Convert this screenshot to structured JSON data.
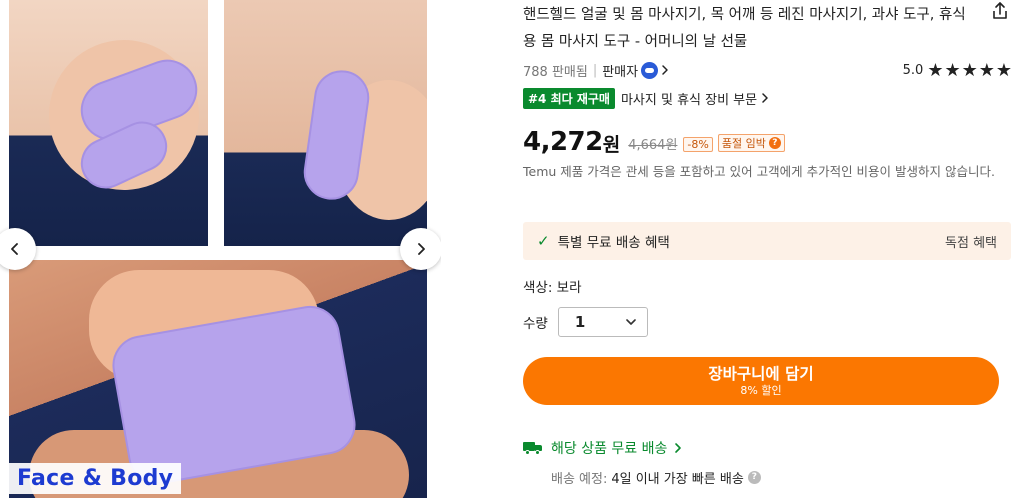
{
  "gallery": {
    "photo_label": "Face & Body",
    "prev_icon": "chevron-left-icon",
    "next_icon": "chevron-right-icon"
  },
  "product": {
    "title": "핸드헬드 얼굴 및 몸 마사지기, 목 어깨 등 레진 마사지기, 과샤 도구, 휴식용 몸 마사지 도구 - 어머니의 날 선물",
    "share_icon": "share-icon",
    "sold_count": "788 판매됨",
    "seller_label": "판매자",
    "rating_value": "5.0",
    "stars": "★★★★★",
    "rank_badge": "#4 최다 재구매",
    "rank_category": "마사지 및 휴식 장비 부문",
    "price": "4,272",
    "price_unit": "원",
    "old_price": "4,664원",
    "discount": "-8%",
    "stock_tag": "품절 임박",
    "notice": "Temu 제품 가격은 관세 등을 포함하고 있어 고객에게 추가적인 비용이 발생하지 않습니다.",
    "benefit_label": "특별 무료 배송 혜택",
    "benefit_right": "독점 혜택",
    "color_label": "색상: 보라",
    "qty_label": "수량",
    "qty_value": "1",
    "cart_label": "장바구니에 담기",
    "cart_sub": "8% 할인",
    "shipping_label": "해당 상품 무료 배송",
    "eta_label": "배송 예정:",
    "eta_value": "4일 이내 가장 빠른 배송"
  },
  "colors": {
    "accent": "#fb7701",
    "green": "#0a8a2e",
    "benefit_bg": "#fdf1e7"
  }
}
